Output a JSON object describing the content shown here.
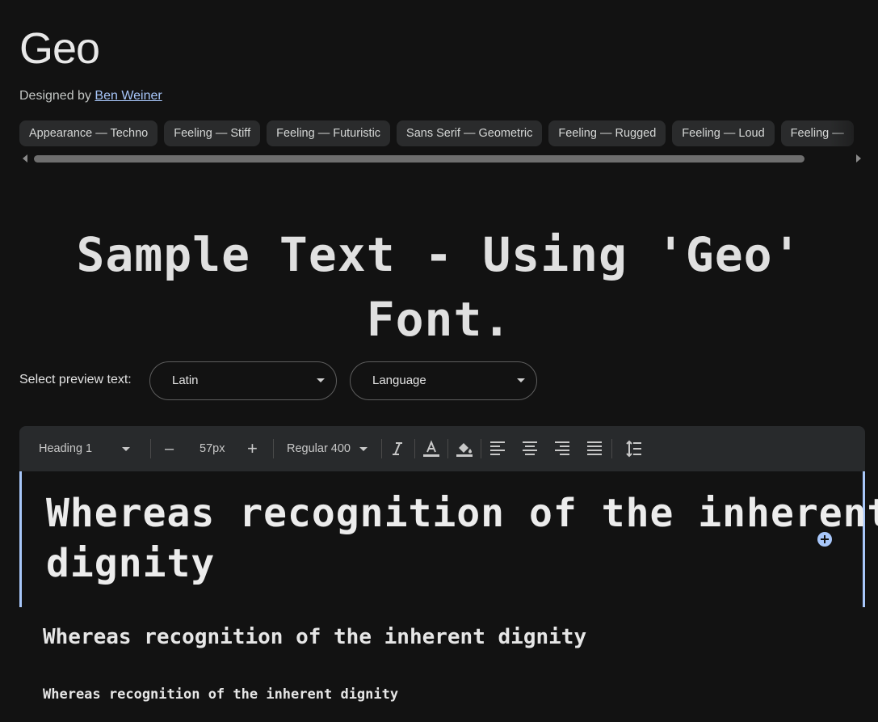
{
  "font": {
    "title": "Geo",
    "designed_by_prefix": "Designed by",
    "designer_name": "Ben Weiner"
  },
  "tags": [
    "Appearance — Techno",
    "Feeling — Stiff",
    "Feeling — Futuristic",
    "Sans Serif — Geometric",
    "Feeling — Rugged",
    "Feeling — Loud",
    "Feeling — "
  ],
  "sample_text": "Sample Text - Using 'Geo' Font.",
  "preview": {
    "label": "Select preview text:",
    "script_value": "Latin",
    "language_value": "Language"
  },
  "toolbar": {
    "style_value": "Heading 1",
    "decrease_label": "–",
    "size_value": "57px",
    "increase_label": "+",
    "weight_value": "Regular 400",
    "icons": [
      "italic-icon",
      "text-color-icon",
      "highlight-color-icon",
      "align-left-icon",
      "align-center-icon",
      "align-right-icon",
      "align-justify-icon",
      "line-height-icon"
    ]
  },
  "editor": {
    "heading1_line1": "Whereas recognition of the inherent",
    "heading1_line2": "dignity",
    "heading2": "Whereas recognition of the inherent dignity",
    "heading3": "Whereas recognition of the inherent dignity"
  },
  "colors": {
    "background": "#121212",
    "accent": "#a8c7fa",
    "chip": "#2a2b2c",
    "toolbar": "#282a2c"
  }
}
